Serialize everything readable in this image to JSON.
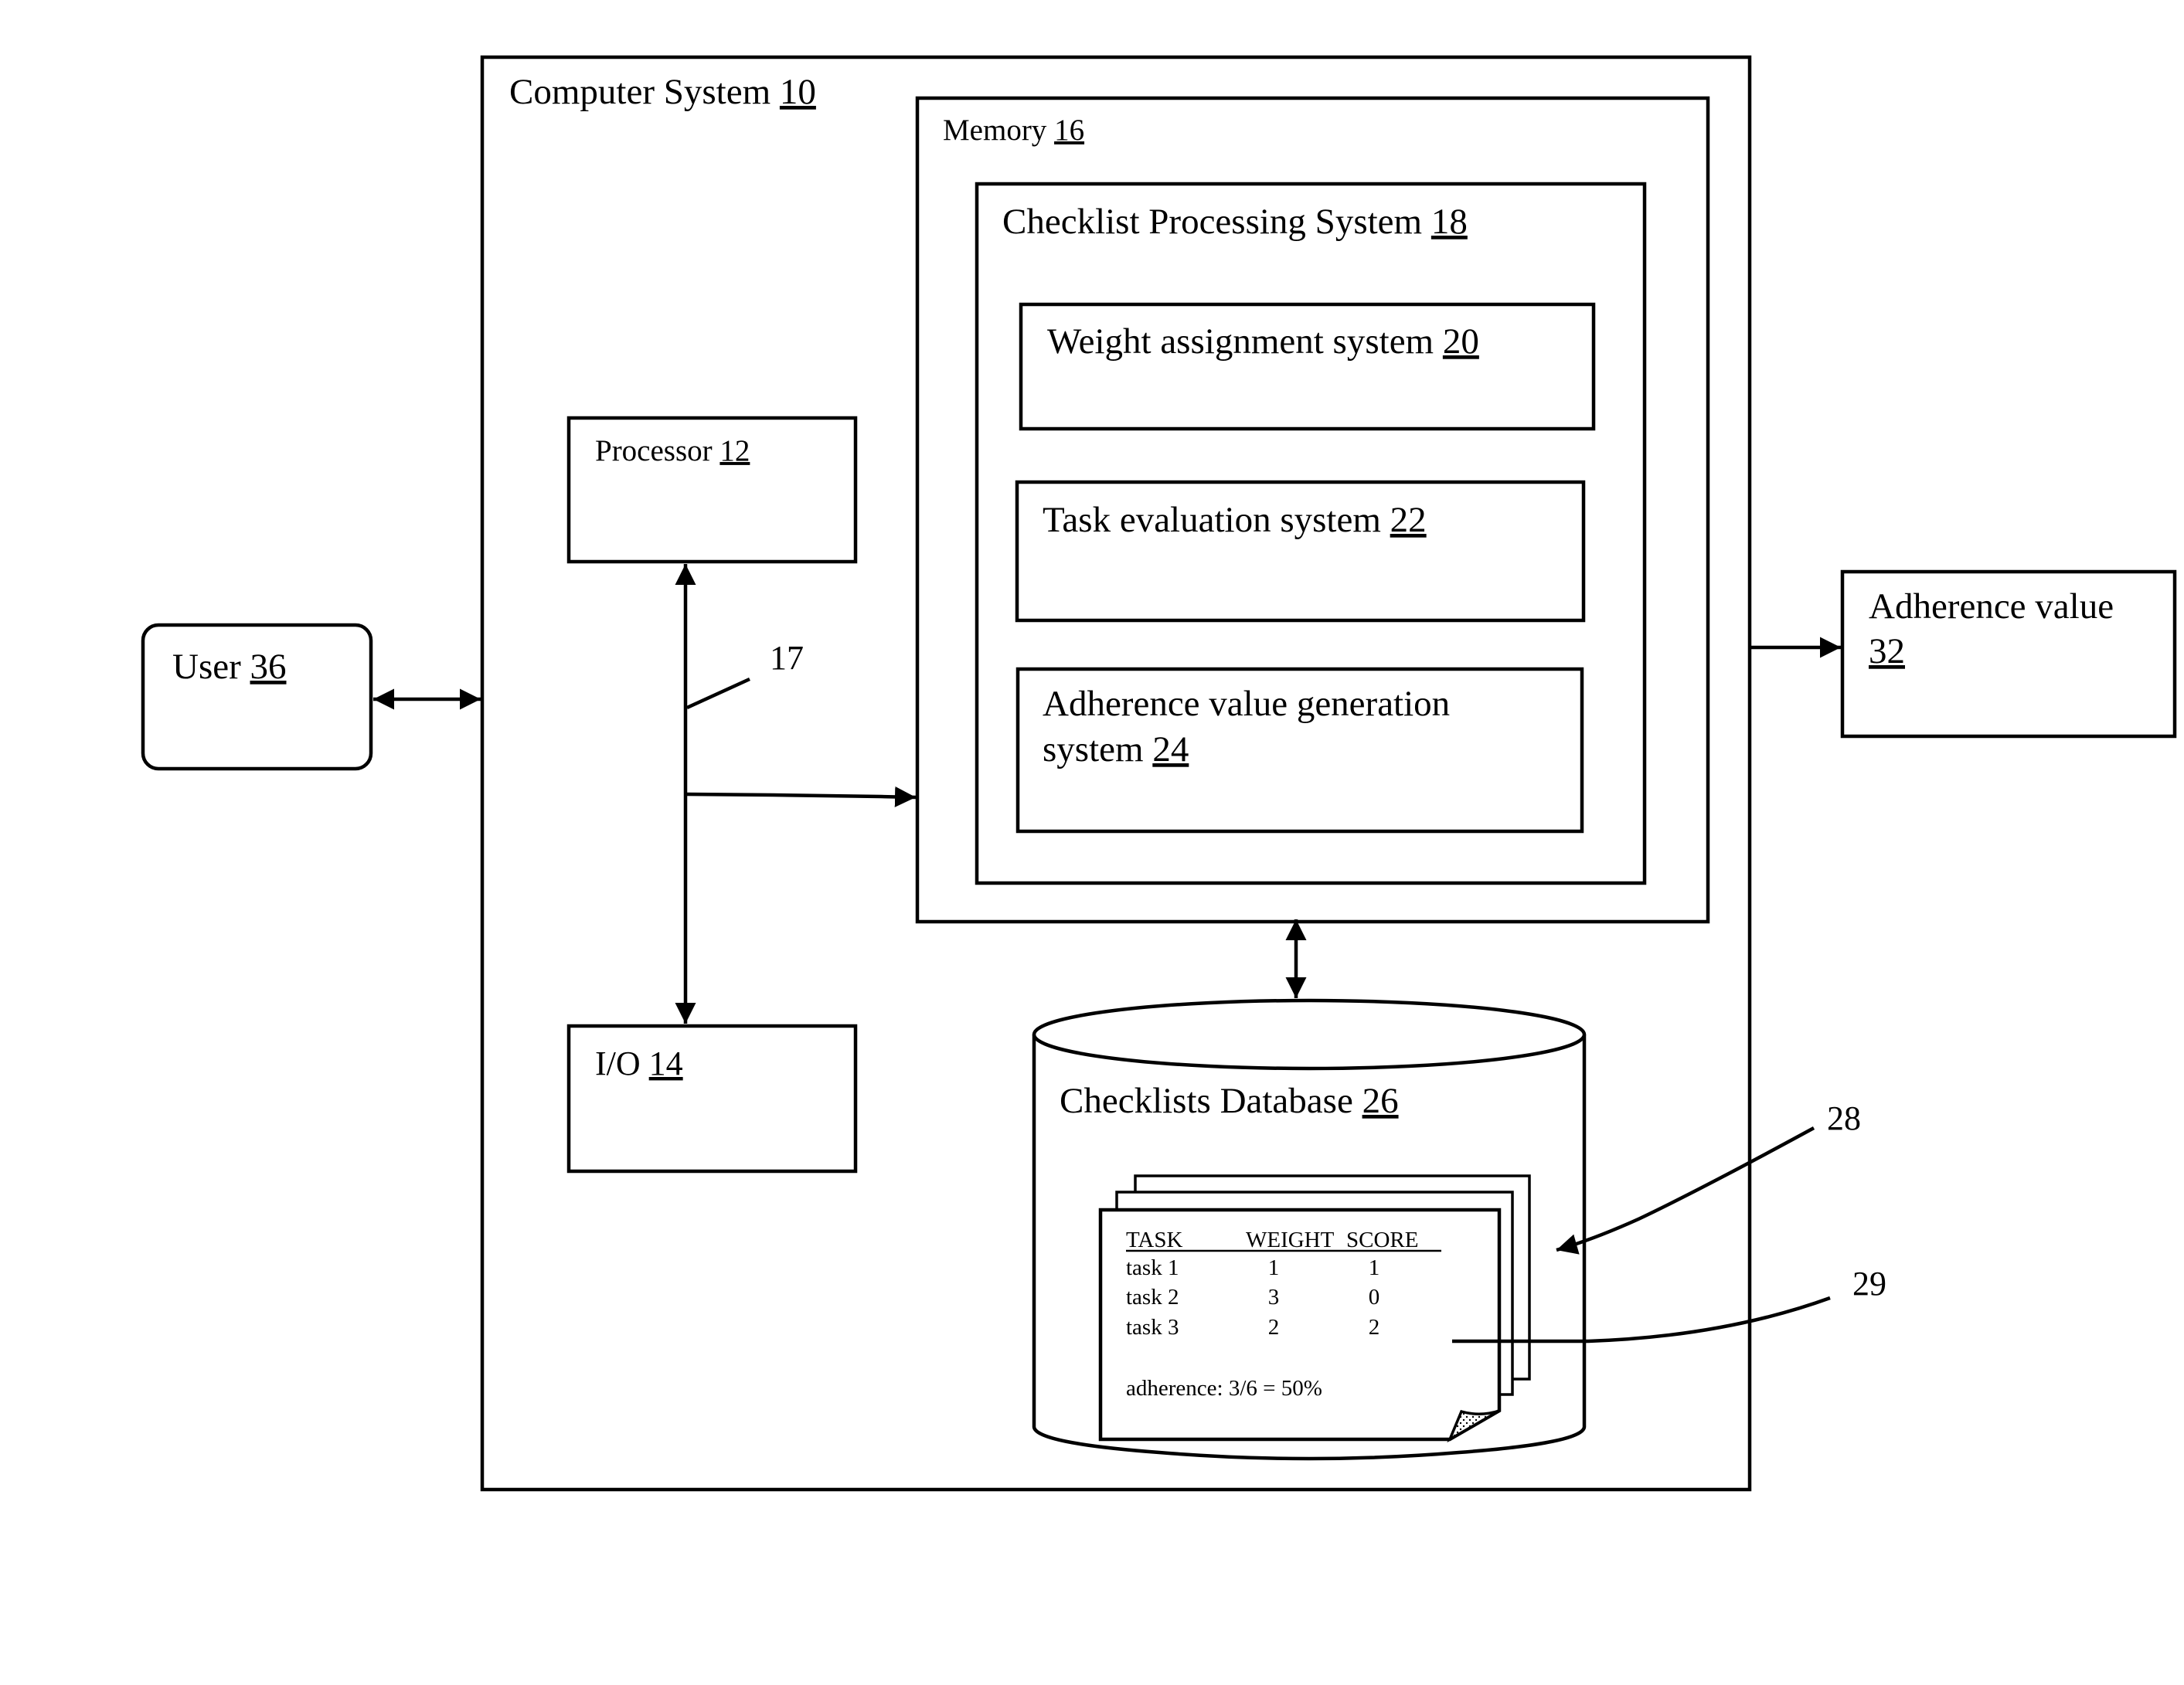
{
  "figure": {
    "computer_system": {
      "label": "Computer System ",
      "ref": "10"
    },
    "processor": {
      "label": "Processor ",
      "ref": "12"
    },
    "io": {
      "label": "I/O ",
      "ref": "14"
    },
    "memory": {
      "label": "Memory ",
      "ref": "16"
    },
    "bus": {
      "ref": "17"
    },
    "checklist_processing_system": {
      "label": "Checklist Processing System ",
      "ref": "18"
    },
    "weight_assignment_system": {
      "label": "Weight assignment system ",
      "ref": "20"
    },
    "task_evaluation_system": {
      "label": "Task evaluation system ",
      "ref": "22"
    },
    "adherence_value_generation_system": {
      "label_line1": "Adherence value generation",
      "label_line2": "system ",
      "ref": "24"
    },
    "checklists_database": {
      "label": "Checklists Database ",
      "ref": "26"
    },
    "checklists": {
      "ref": "28"
    },
    "checklist_detail": {
      "ref": "29"
    },
    "adherence_value": {
      "label_line1": "Adherence value",
      "ref": "32"
    },
    "user": {
      "label": "User ",
      "ref": "36"
    }
  },
  "checklist_table": {
    "headers": [
      "TASK",
      "WEIGHT",
      "SCORE"
    ],
    "rows": [
      {
        "task": "task 1",
        "weight": "1",
        "score": "1"
      },
      {
        "task": "task 2",
        "weight": "3",
        "score": "0"
      },
      {
        "task": "task 3",
        "weight": "2",
        "score": "2"
      }
    ],
    "summary": "adherence: 3/6 = 50%"
  }
}
